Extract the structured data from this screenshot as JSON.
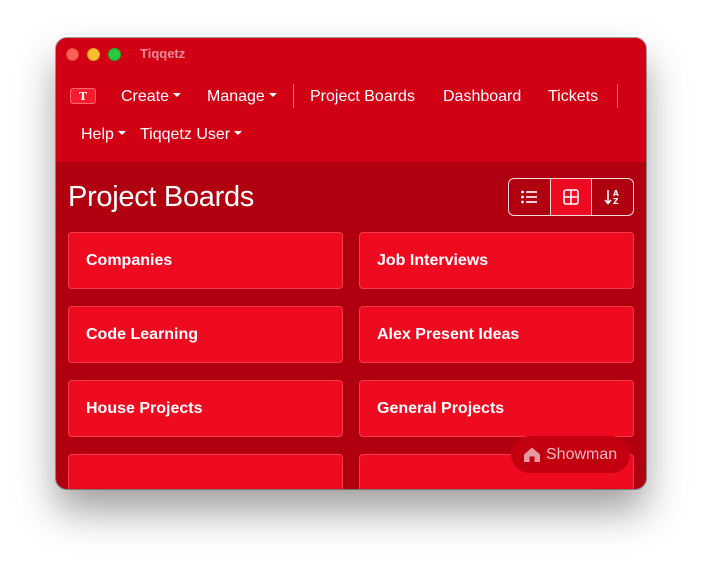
{
  "window": {
    "title": "Tiqqetz"
  },
  "logo": {
    "letter": "T"
  },
  "nav": {
    "create": "Create",
    "manage": "Manage",
    "project_boards": "Project Boards",
    "dashboard": "Dashboard",
    "tickets": "Tickets",
    "help": "Help",
    "user": "Tiqqetz User"
  },
  "page": {
    "title": "Project Boards"
  },
  "view_controls": [
    {
      "icon": "list-icon",
      "active": false
    },
    {
      "icon": "grid-icon",
      "active": true
    },
    {
      "icon": "sort-az-icon",
      "active": false
    }
  ],
  "boards": [
    "Companies",
    "Job Interviews",
    "Code Learning",
    "Alex Present Ideas",
    "House Projects",
    "General Projects",
    "",
    ""
  ],
  "showman": {
    "label": "Showman",
    "icon": "house-icon"
  },
  "colors": {
    "titlebar": "#d20014",
    "content_bg": "#b00010",
    "card": "#ee0b20",
    "active_view": "#ee0a20"
  }
}
